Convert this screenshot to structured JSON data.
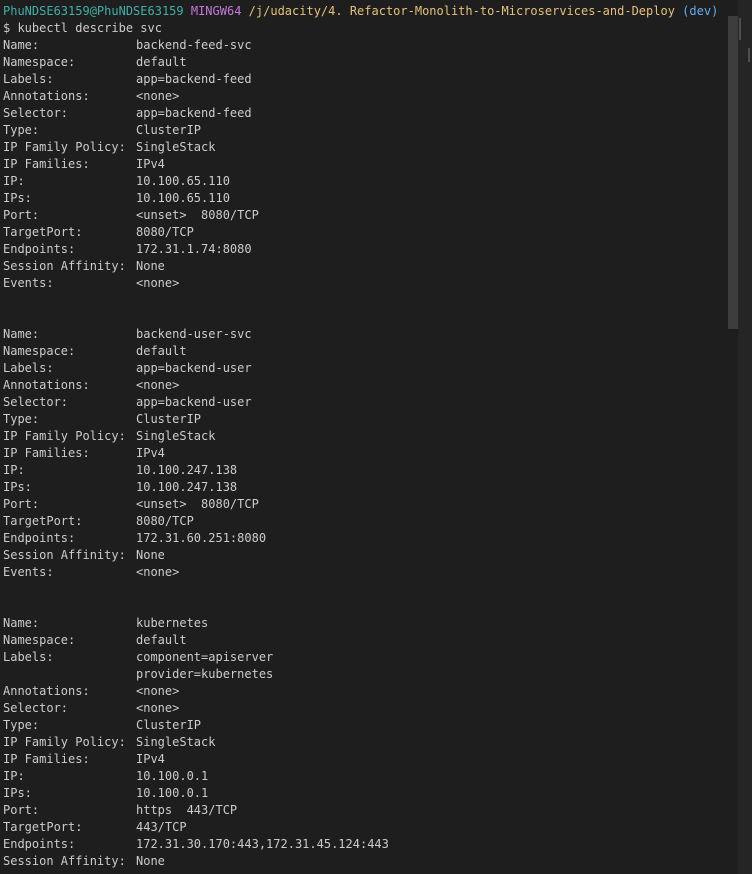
{
  "prompt": {
    "user_host": "PhuNDSE63159@PhuNDSE63159",
    "env": "MINGW64",
    "path": "/j/udacity/4. Refactor-Monolith-to-Microservices-and-Deploy",
    "branch": "(dev)"
  },
  "command": "$ kubectl describe svc",
  "services": [
    {
      "fields": [
        {
          "key": "Name:",
          "value": "backend-feed-svc"
        },
        {
          "key": "Namespace:",
          "value": "default"
        },
        {
          "key": "Labels:",
          "value": "app=backend-feed"
        },
        {
          "key": "Annotations:",
          "value": "<none>"
        },
        {
          "key": "Selector:",
          "value": "app=backend-feed"
        },
        {
          "key": "Type:",
          "value": "ClusterIP"
        },
        {
          "key": "IP Family Policy:",
          "value": "SingleStack"
        },
        {
          "key": "IP Families:",
          "value": "IPv4"
        },
        {
          "key": "IP:",
          "value": "10.100.65.110"
        },
        {
          "key": "IPs:",
          "value": "10.100.65.110"
        },
        {
          "key": "Port:",
          "value": "<unset>  8080/TCP"
        },
        {
          "key": "TargetPort:",
          "value": "8080/TCP"
        },
        {
          "key": "Endpoints:",
          "value": "172.31.1.74:8080"
        },
        {
          "key": "Session Affinity:",
          "value": "None"
        },
        {
          "key": "Events:",
          "value": "<none>"
        }
      ]
    },
    {
      "fields": [
        {
          "key": "Name:",
          "value": "backend-user-svc"
        },
        {
          "key": "Namespace:",
          "value": "default"
        },
        {
          "key": "Labels:",
          "value": "app=backend-user"
        },
        {
          "key": "Annotations:",
          "value": "<none>"
        },
        {
          "key": "Selector:",
          "value": "app=backend-user"
        },
        {
          "key": "Type:",
          "value": "ClusterIP"
        },
        {
          "key": "IP Family Policy:",
          "value": "SingleStack"
        },
        {
          "key": "IP Families:",
          "value": "IPv4"
        },
        {
          "key": "IP:",
          "value": "10.100.247.138"
        },
        {
          "key": "IPs:",
          "value": "10.100.247.138"
        },
        {
          "key": "Port:",
          "value": "<unset>  8080/TCP"
        },
        {
          "key": "TargetPort:",
          "value": "8080/TCP"
        },
        {
          "key": "Endpoints:",
          "value": "172.31.60.251:8080"
        },
        {
          "key": "Session Affinity:",
          "value": "None"
        },
        {
          "key": "Events:",
          "value": "<none>"
        }
      ]
    },
    {
      "fields": [
        {
          "key": "Name:",
          "value": "kubernetes"
        },
        {
          "key": "Namespace:",
          "value": "default"
        },
        {
          "key": "Labels:",
          "value": "component=apiserver"
        },
        {
          "key": "",
          "value": "provider=kubernetes"
        },
        {
          "key": "Annotations:",
          "value": "<none>"
        },
        {
          "key": "Selector:",
          "value": "<none>"
        },
        {
          "key": "Type:",
          "value": "ClusterIP"
        },
        {
          "key": "IP Family Policy:",
          "value": "SingleStack"
        },
        {
          "key": "IP Families:",
          "value": "IPv4"
        },
        {
          "key": "IP:",
          "value": "10.100.0.1"
        },
        {
          "key": "IPs:",
          "value": "10.100.0.1"
        },
        {
          "key": "Port:",
          "value": "https  443/TCP"
        },
        {
          "key": "TargetPort:",
          "value": "443/TCP"
        },
        {
          "key": "Endpoints:",
          "value": "172.31.30.170:443,172.31.45.124:443"
        },
        {
          "key": "Session Affinity:",
          "value": "None"
        }
      ]
    }
  ]
}
